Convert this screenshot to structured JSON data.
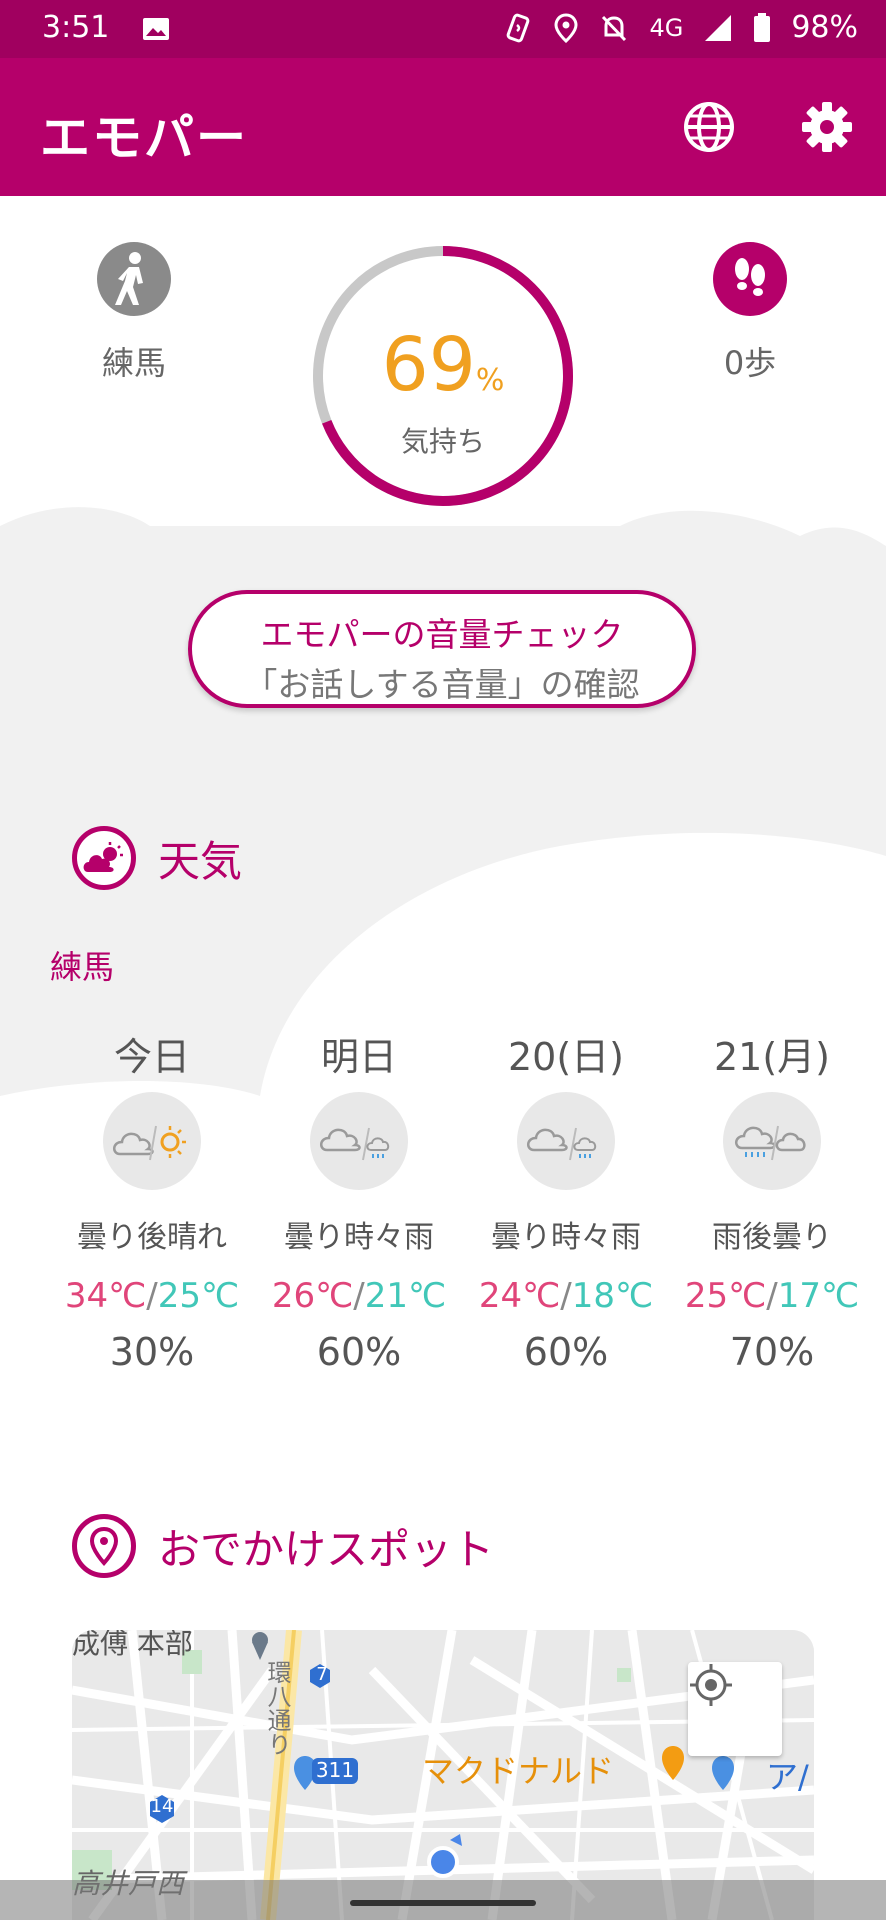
{
  "status_bar": {
    "time": "3:51",
    "network": "4G",
    "battery": "98%"
  },
  "app_bar": {
    "title": "エモパー"
  },
  "location": {
    "name": "練馬"
  },
  "mood": {
    "value": "69",
    "unit": "%",
    "label": "気持ち",
    "fraction": 0.69
  },
  "steps": {
    "label": "0歩"
  },
  "volume_check": {
    "line1": "エモパーの音量チェック",
    "line2": "「お話しする音量」の確認"
  },
  "weather": {
    "title": "天気",
    "location": "練馬",
    "days": [
      {
        "name": "今日",
        "icon": "cloudy-then-sunny-icon",
        "desc": "曇り後晴れ",
        "high": "34℃",
        "low": "25℃",
        "pop": "30%"
      },
      {
        "name": "明日",
        "icon": "cloudy-occasional-rain-icon",
        "desc": "曇り時々雨",
        "high": "26℃",
        "low": "21℃",
        "pop": "60%"
      },
      {
        "name": "20(日)",
        "icon": "cloudy-occasional-rain-icon",
        "desc": "曇り時々雨",
        "high": "24℃",
        "low": "18℃",
        "pop": "60%"
      },
      {
        "name": "21(月)",
        "icon": "rain-then-cloudy-icon",
        "desc": "雨後曇り",
        "high": "25℃",
        "low": "17℃",
        "pop": "70%"
      }
    ],
    "separator": "/"
  },
  "spots": {
    "title": "おでかけスポット",
    "map": {
      "labels": {
        "top_left": "成傅 本部",
        "road": "環八通り",
        "mcdonalds": "マクドナルド",
        "right_cut": "ア/",
        "bottom_left": "高井戸西"
      },
      "route_badges": [
        "7",
        "311",
        "14"
      ]
    }
  },
  "colors": {
    "brand": "#b5006a",
    "status": "#a0005f",
    "mood_value": "#f0a020",
    "temp_high": "#e0457a",
    "temp_low": "#41c7b8"
  }
}
